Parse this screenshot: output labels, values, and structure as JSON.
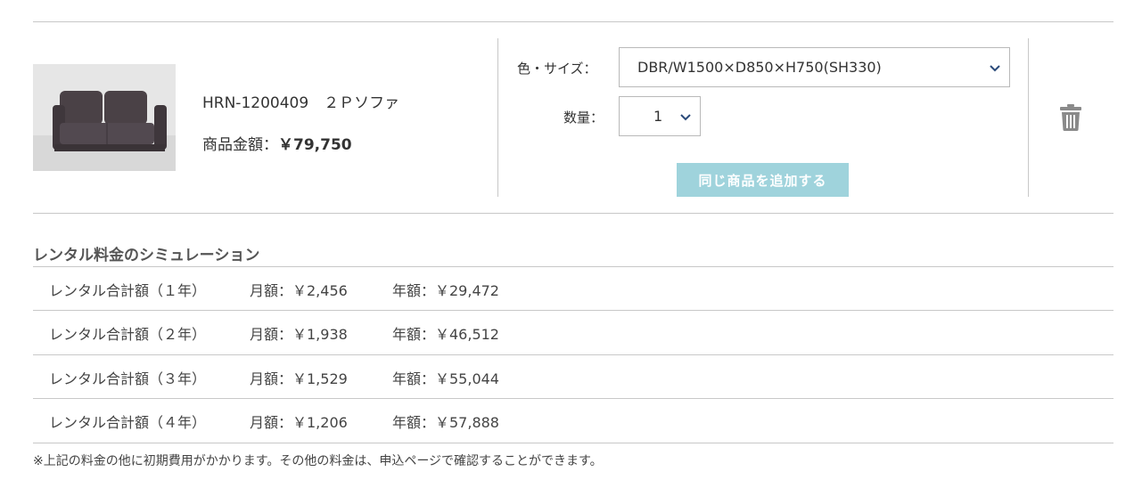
{
  "product": {
    "image_alt": "sofa",
    "name": "HRN-1200409　２Ｐソファ",
    "price_label": "商品金額：",
    "price_value": "￥79,750"
  },
  "options": {
    "size_label": "色・サイズ：",
    "size_value": "DBR/W1500×D850×H750(SH330)",
    "qty_label": "数量：",
    "qty_value": "1",
    "add_button": "同じ商品を追加する"
  },
  "simulation": {
    "title": "レンタル料金のシミュレーション",
    "rows": [
      {
        "term": "レンタル合計額（１年）",
        "monthly": "月額：￥2,456",
        "yearly": "年額：￥29,472"
      },
      {
        "term": "レンタル合計額（２年）",
        "monthly": "月額：￥1,938",
        "yearly": "年額：￥46,512"
      },
      {
        "term": "レンタル合計額（３年）",
        "monthly": "月額：￥1,529",
        "yearly": "年額：￥55,044"
      },
      {
        "term": "レンタル合計額（４年）",
        "monthly": "月額：￥1,206",
        "yearly": "年額：￥57,888"
      }
    ],
    "note": "※上記の料金の他に初期費用がかかります。その他の料金は、申込ページで確認することができます。"
  },
  "colors": {
    "accent_button": "#9fd3dc",
    "chevron": "#2a4a7a",
    "trash": "#8a8a8a"
  }
}
